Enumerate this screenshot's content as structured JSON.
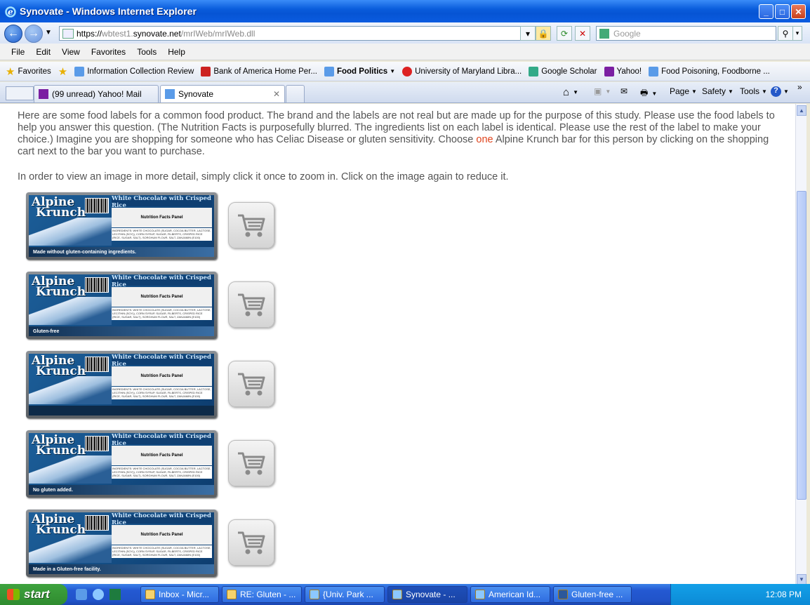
{
  "window": {
    "title": "Synovate - Windows Internet Explorer"
  },
  "address": {
    "url_prefix": "https://",
    "url_host_dim": "wbtest1.",
    "url_host": "synovate.net",
    "url_path": "/mrIWeb/mrIWeb.dll",
    "search_placeholder": "Google"
  },
  "menu": [
    "File",
    "Edit",
    "View",
    "Favorites",
    "Tools",
    "Help"
  ],
  "favorites": {
    "label": "Favorites",
    "items": [
      "Information Collection Review",
      "Bank of America  Home  Per...",
      "Food Politics",
      "University of Maryland Libra...",
      "Google Scholar",
      "Yahoo!",
      "Food Poisoning, Foodborne ..."
    ]
  },
  "tabs": [
    {
      "label": "(99 unread) Yahoo! Mail"
    },
    {
      "label": "Synovate"
    }
  ],
  "commands": {
    "page": "Page",
    "safety": "Safety",
    "tools": "Tools"
  },
  "content": {
    "intro_a": "Here are some food labels for a common food product. The brand and the labels are not real but are made up for the purpose of this study. Please use the food labels to help you answer this question. (The Nutrition Facts is purposefully blurred. The ingredients list on each label is identical. Please use the rest of the label to make your choice.) Imagine you are shopping for someone who has Celiac Disease or gluten sensitivity. Choose ",
    "intro_hl": "one",
    "intro_b": " Alpine Krunch bar for this person by clicking on the shopping cart next to the bar you want to purchase.",
    "zoom_note": "In order to view an image in more detail, simply click it once to zoom in. Click on the image again to reduce it.",
    "products": [
      {
        "brand_1": "Alpine",
        "brand_2": "Krunch",
        "flavor": "White Chocolate with Crisped Rice",
        "panel": "Nutrition Facts Panel",
        "claim": "Made without gluten-containing ingredients."
      },
      {
        "brand_1": "Alpine",
        "brand_2": "Krunch",
        "flavor": "White Chocolate with Crisped Rice",
        "panel": "Nutrition Facts Panel",
        "claim": "Gluten-free"
      },
      {
        "brand_1": "Alpine",
        "brand_2": "Krunch",
        "flavor": "White Chocolate with Crisped Rice",
        "panel": "Nutrition Facts Panel",
        "claim": ""
      },
      {
        "brand_1": "Alpine",
        "brand_2": "Krunch",
        "flavor": "White Chocolate with Crisped Rice",
        "panel": "Nutrition Facts Panel",
        "claim": "No gluten added."
      },
      {
        "brand_1": "Alpine",
        "brand_2": "Krunch",
        "flavor": "White Chocolate with Crisped Rice",
        "panel": "Nutrition Facts Panel",
        "claim": "Made in a Gluten-free facility."
      }
    ],
    "ingredients": "INGREDIENTS: WHITE CHOCOLATE (SUGAR, COCOA BUTTER, LACTOSE, LECITHIN (SOY)), CORN SYRUP, SUGAR, FILBERTS, CRISPED RICE (RICE, SUGAR, SALT), SORGHUM FLOUR, SALT, ZANJAMIN (E100)"
  },
  "taskbar": {
    "start": "start",
    "tasks": [
      "Inbox - Micr...",
      "RE: Gluten - ...",
      "{Univ. Park ...",
      "Synovate - ...",
      "American Id...",
      "Gluten-free ..."
    ],
    "clock": "12:08 PM"
  }
}
